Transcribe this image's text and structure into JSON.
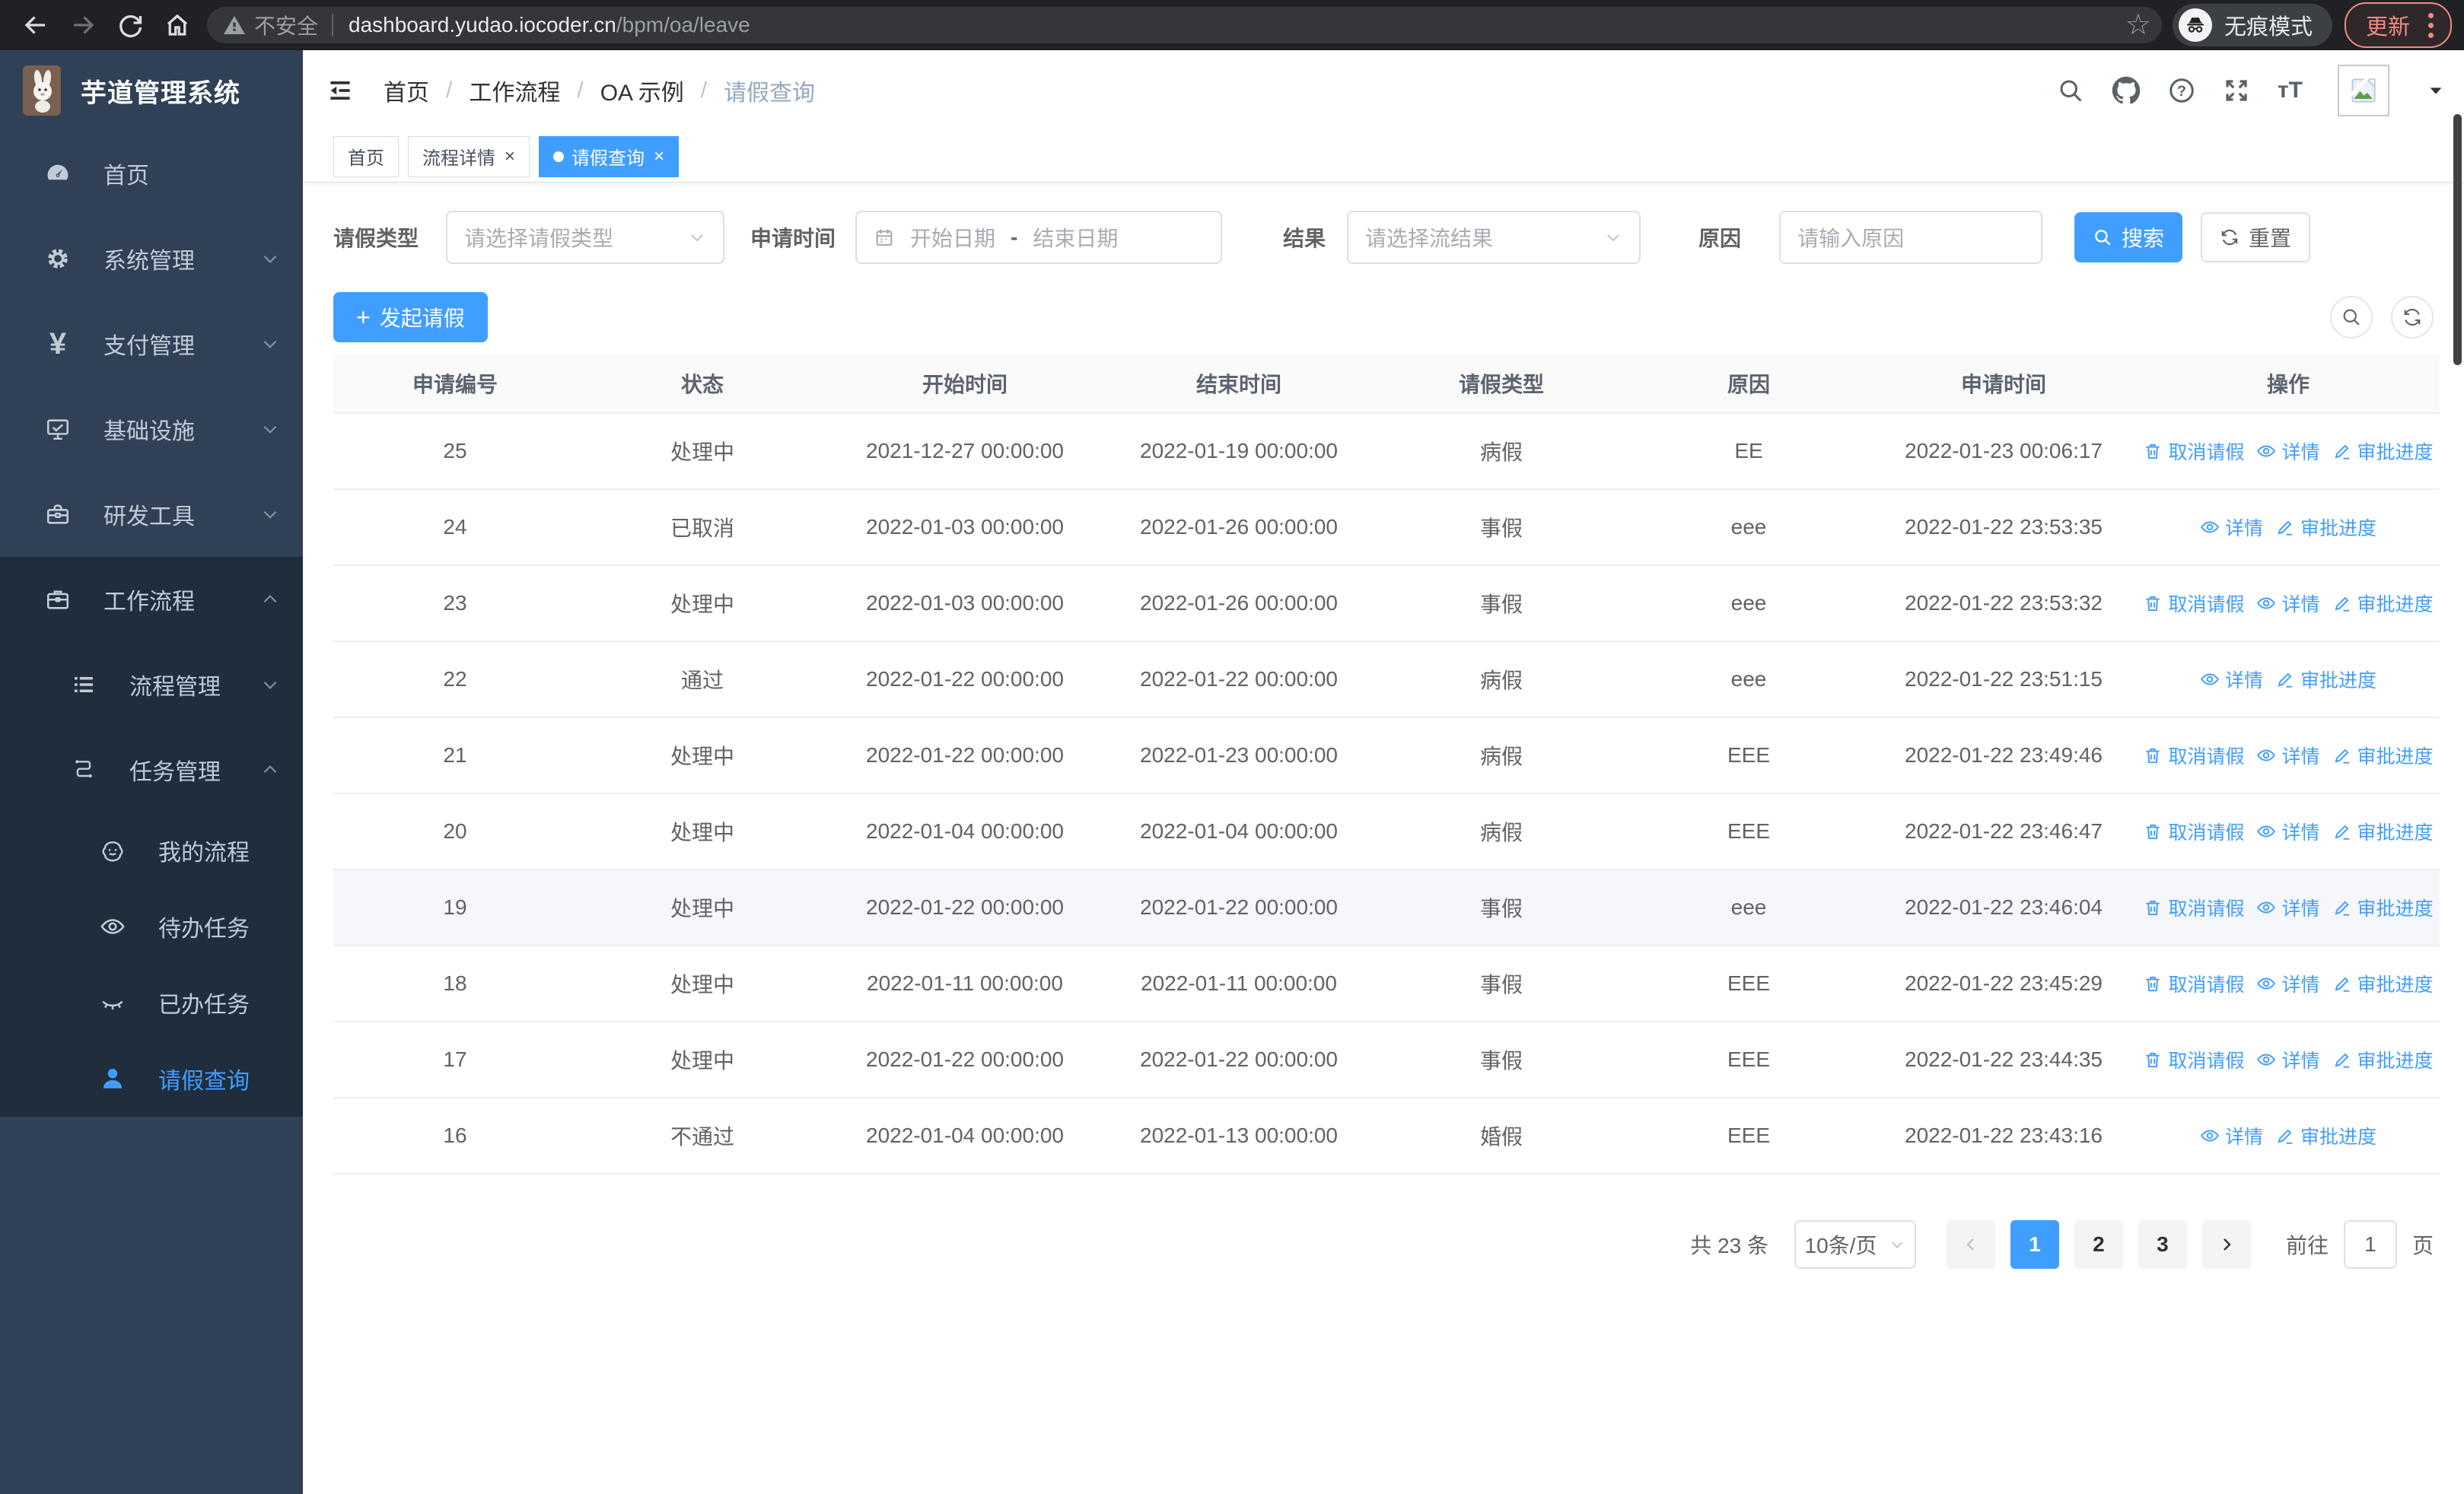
{
  "browser": {
    "security_label": "不安全",
    "url_host": "dashboard.yudao.iocoder.cn",
    "url_path": "/bpm/oa/leave",
    "incognito_label": "无痕模式",
    "update_label": "更新"
  },
  "app": {
    "logo_title": "芋道管理系统"
  },
  "breadcrumb": {
    "items": [
      "首页",
      "工作流程",
      "OA 示例",
      "请假查询"
    ],
    "separator": "/"
  },
  "tabs": [
    {
      "label": "首页"
    },
    {
      "label": "流程详情"
    },
    {
      "label": "请假查询"
    }
  ],
  "sidebar": {
    "items": [
      {
        "label": "首页"
      },
      {
        "label": "系统管理"
      },
      {
        "label": "支付管理"
      },
      {
        "label": "基础设施"
      },
      {
        "label": "研发工具"
      },
      {
        "label": "工作流程"
      },
      {
        "label": "流程管理"
      },
      {
        "label": "任务管理"
      },
      {
        "label": "我的流程"
      },
      {
        "label": "待办任务"
      },
      {
        "label": "已办任务"
      },
      {
        "label": "请假查询"
      }
    ]
  },
  "filters": {
    "leave_type_label": "请假类型",
    "leave_type_placeholder": "请选择请假类型",
    "apply_time_label": "申请时间",
    "date_start_placeholder": "开始日期",
    "date_separator": "-",
    "date_end_placeholder": "结束日期",
    "result_label": "结果",
    "result_placeholder": "请选择流结果",
    "reason_label": "原因",
    "reason_placeholder": "请输入原因",
    "search_label": "搜索",
    "reset_label": "重置"
  },
  "toolbar": {
    "create_label": "发起请假"
  },
  "table": {
    "headers": [
      "申请编号",
      "状态",
      "开始时间",
      "结束时间",
      "请假类型",
      "原因",
      "申请时间",
      "操作"
    ],
    "action_labels": {
      "cancel": "取消请假",
      "detail": "详情",
      "progress": "审批进度"
    },
    "rows": [
      {
        "id": "25",
        "status": "处理中",
        "start": "2021-12-27 00:00:00",
        "end": "2022-01-19 00:00:00",
        "type": "病假",
        "reason": "EE",
        "apply": "2022-01-23 00:06:17",
        "cancel": true,
        "hover": false
      },
      {
        "id": "24",
        "status": "已取消",
        "start": "2022-01-03 00:00:00",
        "end": "2022-01-26 00:00:00",
        "type": "事假",
        "reason": "eee",
        "apply": "2022-01-22 23:53:35",
        "cancel": false,
        "hover": false
      },
      {
        "id": "23",
        "status": "处理中",
        "start": "2022-01-03 00:00:00",
        "end": "2022-01-26 00:00:00",
        "type": "事假",
        "reason": "eee",
        "apply": "2022-01-22 23:53:32",
        "cancel": true,
        "hover": false
      },
      {
        "id": "22",
        "status": "通过",
        "start": "2022-01-22 00:00:00",
        "end": "2022-01-22 00:00:00",
        "type": "病假",
        "reason": "eee",
        "apply": "2022-01-22 23:51:15",
        "cancel": false,
        "hover": false
      },
      {
        "id": "21",
        "status": "处理中",
        "start": "2022-01-22 00:00:00",
        "end": "2022-01-23 00:00:00",
        "type": "病假",
        "reason": "EEE",
        "apply": "2022-01-22 23:49:46",
        "cancel": true,
        "hover": false
      },
      {
        "id": "20",
        "status": "处理中",
        "start": "2022-01-04 00:00:00",
        "end": "2022-01-04 00:00:00",
        "type": "病假",
        "reason": "EEE",
        "apply": "2022-01-22 23:46:47",
        "cancel": true,
        "hover": false
      },
      {
        "id": "19",
        "status": "处理中",
        "start": "2022-01-22 00:00:00",
        "end": "2022-01-22 00:00:00",
        "type": "事假",
        "reason": "eee",
        "apply": "2022-01-22 23:46:04",
        "cancel": true,
        "hover": true
      },
      {
        "id": "18",
        "status": "处理中",
        "start": "2022-01-11 00:00:00",
        "end": "2022-01-11 00:00:00",
        "type": "事假",
        "reason": "EEE",
        "apply": "2022-01-22 23:45:29",
        "cancel": true,
        "hover": false
      },
      {
        "id": "17",
        "status": "处理中",
        "start": "2022-01-22 00:00:00",
        "end": "2022-01-22 00:00:00",
        "type": "事假",
        "reason": "EEE",
        "apply": "2022-01-22 23:44:35",
        "cancel": true,
        "hover": false
      },
      {
        "id": "16",
        "status": "不通过",
        "start": "2022-01-04 00:00:00",
        "end": "2022-01-13 00:00:00",
        "type": "婚假",
        "reason": "EEE",
        "apply": "2022-01-22 23:43:16",
        "cancel": false,
        "hover": false
      }
    ]
  },
  "pagination": {
    "total_label": "共 23 条",
    "page_size": "10条/页",
    "pages": [
      "1",
      "2",
      "3"
    ],
    "active_page": "1",
    "goto_label": "前往",
    "goto_value": "1",
    "unit_label": "页"
  },
  "colors": {
    "primary": "#409eff",
    "sidebar_bg": "#304156",
    "submenu_bg": "#1f2d3d",
    "chrome_bg": "#202124",
    "update_accent": "#f28b82",
    "table_border": "#ebeef5",
    "hover_row_bg": "#f5f7fa"
  }
}
